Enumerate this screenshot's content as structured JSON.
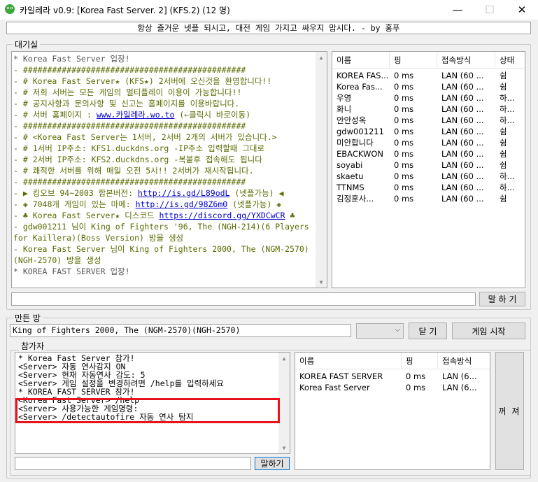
{
  "window": {
    "title": "카일레라 v0.9: [Korea Fast Server. 2] (KFS.2) (12 명)",
    "minimize": "—",
    "maximize": "☐",
    "close": "✕"
  },
  "motd": "항상 즐거운 넷플 되시고, 대전 게임 가지고 싸우지 맙시다. - by 홍푸",
  "lobby": {
    "label": "대기실",
    "messages": [
      {
        "text": "* Korea Fast Server 입장!",
        "style": "header"
      },
      {
        "text": "- ##############################################",
        "style": "info"
      },
      {
        "text": "- # Korea Fast Server★ (KFS★) 2서버에 오신것을 환영합니다!!",
        "style": "info"
      },
      {
        "text": "- # 저희 서버는 모든 게임의 멀티플레이 이용이 가능합니다!!",
        "style": "info"
      },
      {
        "text": "- # 공지사항과 문의사항 및 신고는 홈페이지를 이용바랍니다.",
        "style": "info"
      },
      {
        "text": "- # 서버 홈페이지 : ",
        "link": "www.카일레라.wo.to",
        "after": " (←클릭시 바로이동)",
        "style": "info"
      },
      {
        "text": "- ##############################################",
        "style": "info"
      },
      {
        "text": "- # <Korea Fast Server는 1서버, 2서버 2개의 서버가 있습니다.>",
        "style": "info"
      },
      {
        "text": "- # 1서버 IP주소: KFS1.duckdns.org -IP주소 입력할때 그대로",
        "style": "info"
      },
      {
        "text": "- # 2서버 IP주소: KFS2.duckdns.org -복붙후 접속해도 됩니다",
        "style": "info"
      },
      {
        "text": "- # 쾌적한 서버를 위해 매일 오전 5시!! 2서버가 재시작됩니다.",
        "style": "info"
      },
      {
        "text": "- ##############################################",
        "style": "info"
      },
      {
        "text": "- ▶ 킹오브 94~2003 합본버전: ",
        "link": "http://is.gd/L89odL",
        "after": " (넷플가능) ◀",
        "style": "info"
      },
      {
        "text": "- ◈ 7048개 게임이 있는 마메: ",
        "link": "http://is.gd/98Z6m0",
        "after": " (넷플가능) ◈",
        "style": "info"
      },
      {
        "text": "- ♣ Korea Fast Server★ 디스코드 ",
        "link": "https://discord.gg/YXDCwCR",
        "after": " ♣",
        "style": "info"
      },
      {
        "text": "- gdw001211 님이 King of Fighters '96, The (NGH-214)(6 Players for Kaillera)(Boss Version) 방을 생성",
        "style": "info"
      },
      {
        "text": "- Korea Fast Server 님이 King of Fighters 2000, The (NGM-2570)(NGH-2570) 방을 생성",
        "style": "info"
      },
      {
        "text": "* KOREA FAST SERVER 입장!",
        "style": "header"
      }
    ],
    "send_button": "말 하 기",
    "input_value": ""
  },
  "user_list": {
    "columns": [
      "이름",
      "핑",
      "접속방식",
      "상태"
    ],
    "rows": [
      [
        "KOREA FAS...",
        "0 ms",
        "LAN (60 ...",
        "쉼"
      ],
      [
        "Korea Fas...",
        "0 ms",
        "LAN (60 ...",
        "쉼"
      ],
      [
        "우영",
        "0 ms",
        "LAN (60 ...",
        "하..."
      ],
      [
        "화니",
        "0 ms",
        "LAN (60 ...",
        "하..."
      ],
      [
        "안안성옥",
        "0 ms",
        "LAN (60 ...",
        "하..."
      ],
      [
        "gdw001211",
        "0 ms",
        "LAN (60 ...",
        "쉼"
      ],
      [
        "미안합니다",
        "0 ms",
        "LAN (60 ...",
        "쉼"
      ],
      [
        "EBACKWON",
        "0 ms",
        "LAN (60 ...",
        "쉼"
      ],
      [
        "soyabi",
        "0 ms",
        "LAN (60 ...",
        "쉼"
      ],
      [
        "skaetu",
        "0 ms",
        "LAN (60 ...",
        "하..."
      ],
      [
        "TTNMS",
        "0 ms",
        "LAN (60 ...",
        "하..."
      ],
      [
        "김정훈사...",
        "0 ms",
        "LAN (60 ...",
        "쉼"
      ]
    ]
  },
  "created_room": {
    "label": "만든 방",
    "game_name": "King of Fighters 2000, The (NGM-2570)(NGH-2570)",
    "leave_button": "닫 기",
    "start_button": "게임 시작"
  },
  "participants": {
    "label": "참가자",
    "messages": [
      "* Korea Fast Server 참가!",
      "<Server> 자동 연사감지 ON",
      "<Server> 현재 자동연사 감도: 5",
      "<Server> 게임 설정을 변경하려면 /help를 입력하세요",
      "* KOREA FAST SERVER 참가!",
      "<Korea Fast Server> /help",
      "<Server> 사용가능한 게임명령:",
      "<Server> /detectautofire 자동 연사 탐지"
    ],
    "send_button": "말하기",
    "input_value": "",
    "columns": [
      "이름",
      "핑",
      "접속방식"
    ],
    "rows": [
      [
        "KOREA FAST SERVER",
        "0 ms",
        "LAN (6..."
      ],
      [
        "Korea Fast Server",
        "0 ms",
        "LAN (6..."
      ]
    ],
    "kick_button": "꺼 져"
  },
  "colors": {
    "highlight_box": "#e8141c",
    "lobby_text": "#5b6a00",
    "link": "#0000cc"
  }
}
